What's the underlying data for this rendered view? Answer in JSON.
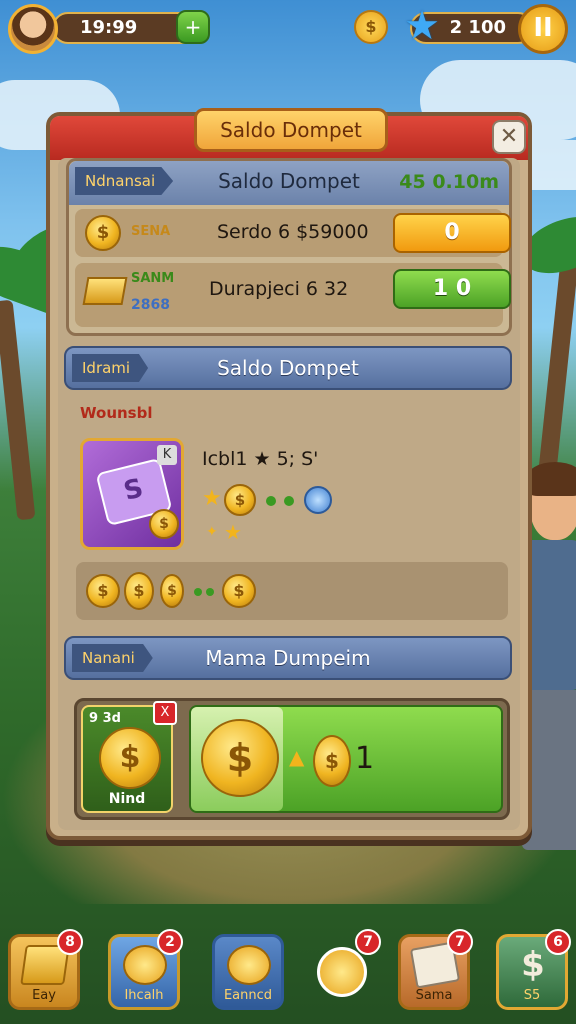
{
  "hud": {
    "time": "19:99",
    "plus": "+",
    "coin_glyph": "$",
    "gems": "2 100",
    "pause": "II"
  },
  "dialog": {
    "title": "Saldo Dompet",
    "close": "✕",
    "wallet": {
      "tag": "Ndnansai",
      "title": "Saldo Dompet",
      "balance": "45 0.10m",
      "rows": [
        {
          "label": "SENA",
          "text": "Serdo 6 $59000",
          "button": "0"
        },
        {
          "label": "SANM",
          "sub": "2868",
          "text": "Durapjeci 6 32",
          "button": "1 0"
        }
      ]
    },
    "reward": {
      "tag": "Idrami",
      "title": "Saldo Dompet",
      "subtag": "Wounsbl",
      "item_text": "Icbl1 ★ 5; S'",
      "corner": "K"
    },
    "shop": {
      "tag": "Nanani",
      "title": "Mama Dumpeim",
      "card_label_top": "9 3d",
      "card_label_bottom": "Nind",
      "card_badge": "X",
      "amount": "1"
    }
  },
  "nav": [
    {
      "label": "Eay",
      "badge": "8",
      "icon": "gold-bars-icon"
    },
    {
      "label": "Ihcalh",
      "badge": "2",
      "icon": "trophy-icon"
    },
    {
      "label": "Eanncd",
      "badge": "",
      "icon": "coin-stack-icon"
    },
    {
      "label": "",
      "badge": "7",
      "icon": "coin-icon"
    },
    {
      "label": "Sama",
      "badge": "7",
      "icon": "cash-icon"
    },
    {
      "label": "S5",
      "badge": "6",
      "icon": "money-icon"
    }
  ],
  "colors": {
    "accent_red": "#d8262a",
    "panel": "#c9b08a",
    "header_blue": "#56709f",
    "green": "#4ca226",
    "orange": "#f19a0f"
  }
}
